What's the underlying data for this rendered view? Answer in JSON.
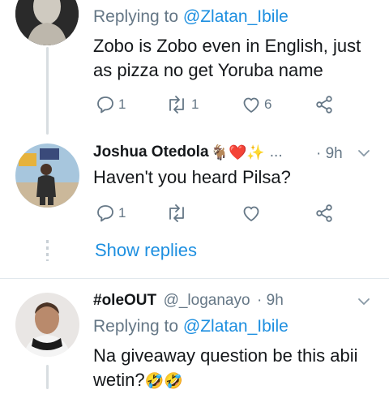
{
  "tweet1": {
    "replying_prefix": "Replying to ",
    "replying_mention": "@Zlatan_Ibile",
    "text_line1": "Zobo is Zobo even in English, just",
    "text_line2": "as pizza no get Yoruba name",
    "reply_count": "1",
    "retweet_count": "1",
    "like_count": "6"
  },
  "tweet2": {
    "name": "Joshua Otedola",
    "name_emojis": "🐐❤️✨",
    "ellipsis": "...",
    "time": "· 9h",
    "text": "Haven't you heard Pilsa?",
    "reply_count": "1",
    "show_replies": "Show replies"
  },
  "tweet3": {
    "name": "#oleOUT",
    "handle": "@_loganayo",
    "time": "· 9h",
    "replying_prefix": "Replying to ",
    "replying_mention": "@Zlatan_Ibile",
    "text_line1": "Na giveaway question be this abii",
    "text_line2": "wetin?",
    "text_emojis": "🤣🤣"
  },
  "colors": {
    "accent": "#1d8fe0",
    "muted": "#657786",
    "like_red": "#e0245e"
  },
  "icons": [
    "reply-icon",
    "retweet-icon",
    "like-icon",
    "share-icon",
    "chevron-down-icon"
  ]
}
